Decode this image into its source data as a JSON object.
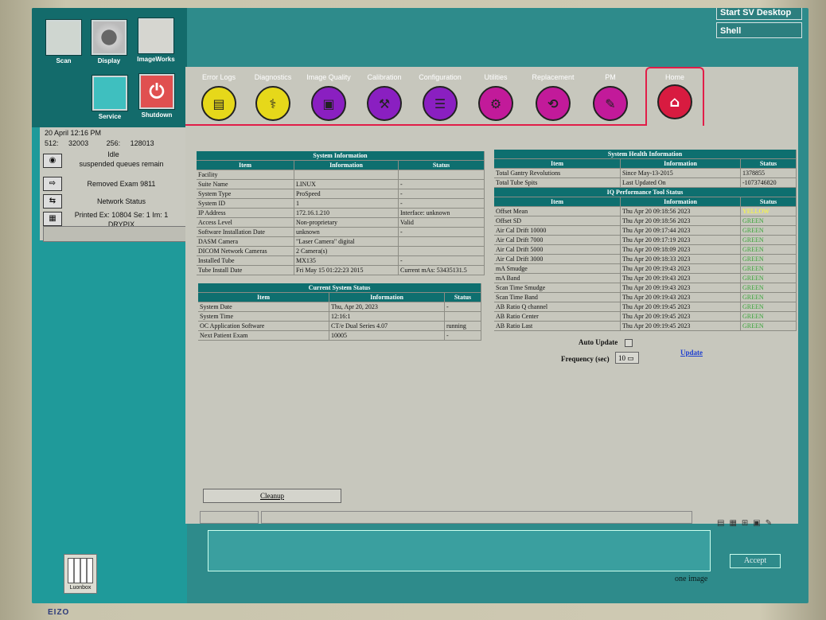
{
  "topbar": {
    "start_sv": "Start SV Desktop",
    "shell": "Shell"
  },
  "left_icons": [
    {
      "label": "Scan"
    },
    {
      "label": "Display"
    },
    {
      "label": "ImageWorks"
    },
    {
      "label": "Service"
    },
    {
      "label": "Shutdown"
    }
  ],
  "status": {
    "datetime": "20 April 12:16 PM",
    "counts": {
      "a_label": "512:",
      "a": "32003",
      "b_label": "256:",
      "b": "128013"
    },
    "idle": "Idle",
    "queues": "suspended queues remain",
    "removed": "Removed Exam  9811",
    "network": "Network Status",
    "printed": "Printed  Ex: 10804 Se: 1 Im: 1",
    "printer": "DRYPIX"
  },
  "luonbox": "Luonbox",
  "tabs": [
    "Error Logs",
    "Diagnostics",
    "Image Quality",
    "Calibration",
    "Configuration",
    "Utilities",
    "Replacement",
    "PM",
    "Home"
  ],
  "system_info": {
    "title": "System Information",
    "headers": [
      "Item",
      "Information",
      "Status"
    ],
    "rows": [
      [
        "Facility",
        "",
        ""
      ],
      [
        "Suite Name",
        "LINUX",
        "-"
      ],
      [
        "System Type",
        "ProSpeed",
        "-"
      ],
      [
        "System ID",
        "1",
        "-"
      ],
      [
        "IP Address",
        "172.16.1.210",
        "Interface: unknown"
      ],
      [
        "Access Level",
        "Non-proprietary",
        "Valid"
      ],
      [
        "Software Installation Date",
        "unknown",
        "-"
      ],
      [
        "DASM Camera",
        "\"Laser Camera\" digital",
        ""
      ],
      [
        "DICOM Network Cameras",
        "2 Camera(s)",
        ""
      ],
      [
        "Installed Tube",
        "MX135",
        "-"
      ],
      [
        "Tube Install Date",
        "Fri May 15 01:22:23 2015",
        "Current mAs: 53435131.5"
      ]
    ]
  },
  "current_status": {
    "title": "Current System Status",
    "headers": [
      "Item",
      "Information",
      "Status"
    ],
    "rows": [
      [
        "System Date",
        "Thu, Apr 20, 2023",
        "-"
      ],
      [
        "System Time",
        "12:16:1",
        ""
      ],
      [
        "OC Application Software",
        "CT/e Dual Series 4.07",
        "running"
      ],
      [
        "Next Patient Exam",
        "10005",
        "-"
      ]
    ]
  },
  "health": {
    "title": "System Health Information",
    "headers": [
      "Item",
      "Information",
      "Status"
    ],
    "rows": [
      [
        "Total Gantry Revolutions",
        "Since May-13-2015",
        "1378855"
      ],
      [
        "Total Tube Spits",
        "Last Updated On",
        "-1073746820"
      ]
    ]
  },
  "iq": {
    "title": "IQ Performance Tool Status",
    "headers": [
      "Item",
      "Information",
      "Status"
    ],
    "rows": [
      [
        "Offset Mean",
        "Thu Apr 20 09:18:56 2023",
        "YELLOW"
      ],
      [
        "Offset SD",
        "Thu Apr 20 09:18:56 2023",
        "GREEN"
      ],
      [
        "Air Cal Drift 10000",
        "Thu Apr 20 09:17:44 2023",
        "GREEN"
      ],
      [
        "Air Cal Drift 7000",
        "Thu Apr 20 09:17:19 2023",
        "GREEN"
      ],
      [
        "Air Cal Drift 5000",
        "Thu Apr 20 09:18:09 2023",
        "GREEN"
      ],
      [
        "Air Cal Drift 3000",
        "Thu Apr 20 09:18:33 2023",
        "GREEN"
      ],
      [
        "mA Smudge",
        "Thu Apr 20 09:19:43 2023",
        "GREEN"
      ],
      [
        "mA Band",
        "Thu Apr 20 09:19:43 2023",
        "GREEN"
      ],
      [
        "Scan Time Smudge",
        "Thu Apr 20 09:19:43 2023",
        "GREEN"
      ],
      [
        "Scan Time Band",
        "Thu Apr 20 09:19:43 2023",
        "GREEN"
      ],
      [
        "AB Ratio Q channel",
        "Thu Apr 20 09:19:45 2023",
        "GREEN"
      ],
      [
        "AB Ratio Center",
        "Thu Apr 20 09:19:45 2023",
        "GREEN"
      ],
      [
        "AB Ratio Last",
        "Thu Apr 20 09:19:45 2023",
        "GREEN"
      ]
    ]
  },
  "controls": {
    "auto_update": "Auto Update",
    "frequency_label": "Frequency (sec)",
    "frequency_value": "10",
    "update_link": "Update",
    "cleanup": "Cleanup"
  },
  "bottom": {
    "accept": "Accept",
    "one_image": "one image"
  },
  "colors": {
    "teal": "#1f9a9a",
    "panel": "#c7c7bd",
    "header": "#0e6f6f",
    "accent": "#e11d48",
    "tab_yellow": "#e6d81a",
    "tab_purple": "#8a1fc1",
    "tab_magenta": "#c21a9a",
    "home_red": "#d81b40"
  },
  "brand": "EIZO"
}
